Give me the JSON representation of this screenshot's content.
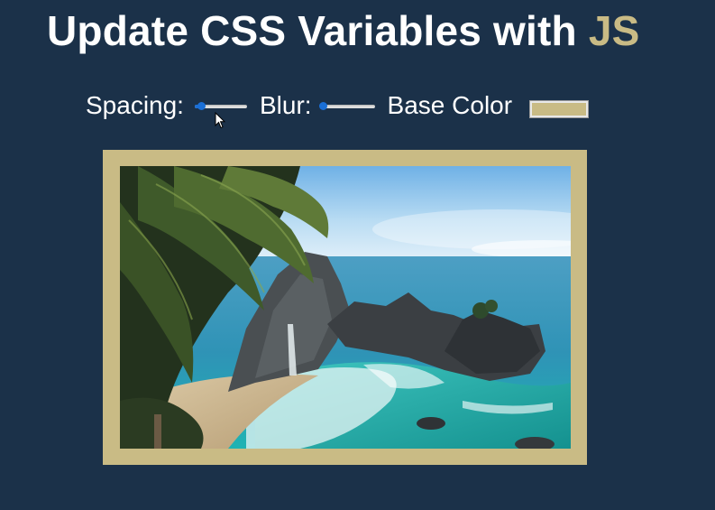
{
  "header": {
    "title_main": "Update CSS Variables with ",
    "title_accent": "JS"
  },
  "controls": {
    "spacing": {
      "label": "Spacing:",
      "value_fraction": 0.12
    },
    "blur": {
      "label": "Blur:",
      "value_fraction": 0.0
    },
    "base_color": {
      "label": "Base Color",
      "value": "#c9bb85"
    }
  },
  "colors": {
    "background": "#1b3149",
    "accent": "#c9bb85",
    "slider": "#1a6fd6"
  },
  "image": {
    "icon": "coastal-landscape-photo"
  }
}
